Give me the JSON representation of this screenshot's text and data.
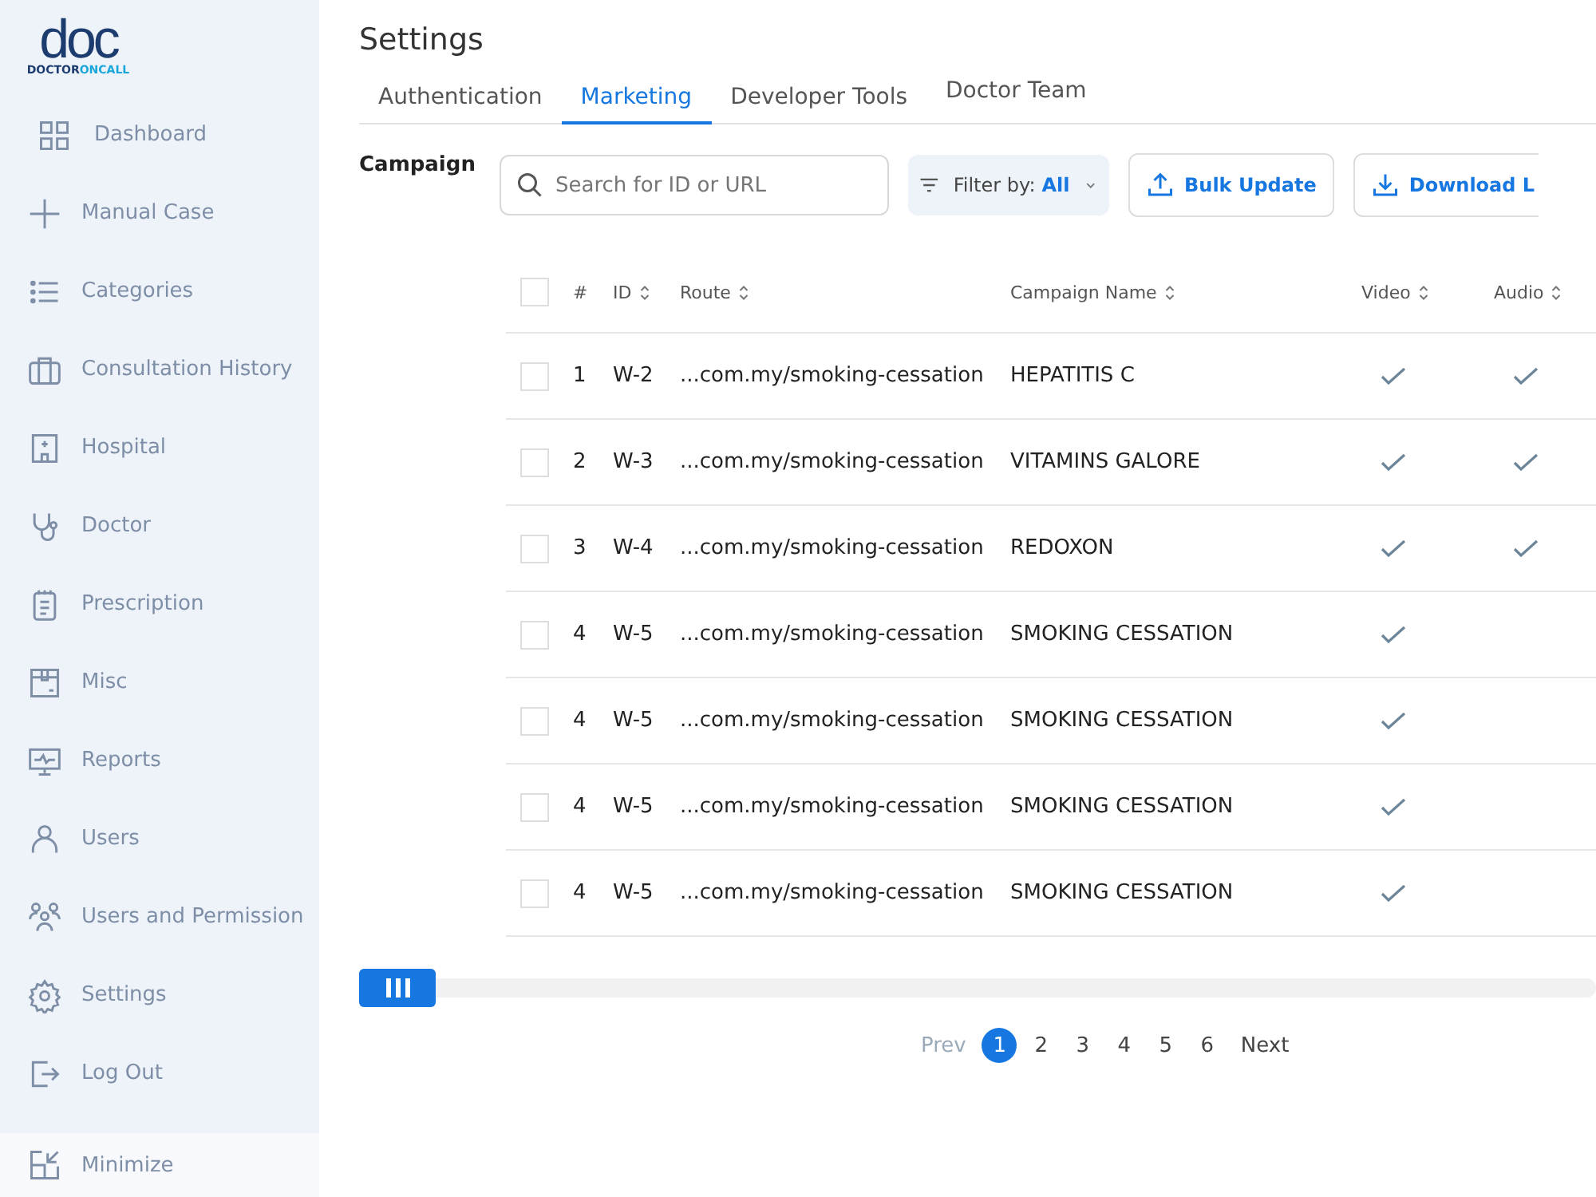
{
  "logo": {
    "mark": "doc",
    "name_a": "DOCTOR",
    "name_b": "ONCALL"
  },
  "sidebar": {
    "items": [
      {
        "label": "Dashboard",
        "selected": false
      },
      {
        "label": "Manual Case",
        "selected": false
      },
      {
        "label": "Categories",
        "selected": false
      },
      {
        "label": "Consultation History",
        "selected": false
      },
      {
        "label": "Hospital",
        "selected": false
      },
      {
        "label": "Doctor",
        "selected": false
      },
      {
        "label": "Prescription",
        "selected": false
      },
      {
        "label": "Misc",
        "selected": false
      },
      {
        "label": "Reports",
        "selected": false
      },
      {
        "label": "Users",
        "selected": false
      },
      {
        "label": "Users and Permission",
        "selected": false
      },
      {
        "label": "Settings",
        "selected": false
      },
      {
        "label": "Log Out",
        "selected": false
      }
    ],
    "minimize": "Minimize"
  },
  "page_title": "Settings",
  "tabs": [
    {
      "label": "Authentication",
      "selected": false
    },
    {
      "label": "Marketing",
      "selected": true
    },
    {
      "label": "Developer Tools",
      "selected": false
    },
    {
      "label": "Doctor Team",
      "selected": false
    }
  ],
  "section_label": "Campaign",
  "search": {
    "placeholder": "Search for ID or URL"
  },
  "filter": {
    "label": "Filter by:",
    "value": "All"
  },
  "buttons": [
    {
      "label": "Bulk Update",
      "kind": "upload"
    },
    {
      "label": "Download L",
      "kind": "download"
    }
  ],
  "table": {
    "select_all": {
      "checked": false
    },
    "columns": [
      "#",
      "ID",
      "Route",
      "Campaign Name",
      "Video",
      "Audio"
    ],
    "rows": [
      {
        "checked": false,
        "num": "1",
        "id": "W-2",
        "route": "...com.my/smoking-cessation",
        "campaign": "HEPATITIS C",
        "video": true,
        "audio": true
      },
      {
        "checked": false,
        "num": "2",
        "id": "W-3",
        "route": "...com.my/smoking-cessation",
        "campaign": "VITAMINS GALORE",
        "video": true,
        "audio": true
      },
      {
        "checked": false,
        "num": "3",
        "id": "W-4",
        "route": "...com.my/smoking-cessation",
        "campaign": "REDOXON",
        "video": true,
        "audio": true
      },
      {
        "checked": false,
        "num": "4",
        "id": "W-5",
        "route": "...com.my/smoking-cessation",
        "campaign": "SMOKING CESSATION",
        "video": true,
        "audio": false
      },
      {
        "checked": false,
        "num": "4",
        "id": "W-5",
        "route": "...com.my/smoking-cessation",
        "campaign": "SMOKING CESSATION",
        "video": true,
        "audio": false
      },
      {
        "checked": false,
        "num": "4",
        "id": "W-5",
        "route": "...com.my/smoking-cessation",
        "campaign": "SMOKING CESSATION",
        "video": true,
        "audio": false
      },
      {
        "checked": false,
        "num": "4",
        "id": "W-5",
        "route": "...com.my/smoking-cessation",
        "campaign": "SMOKING CESSATION",
        "video": true,
        "audio": false
      }
    ]
  },
  "pagination": {
    "prev": {
      "label": "Prev",
      "disabled": true
    },
    "pages": [
      {
        "label": "1",
        "selected": true
      },
      {
        "label": "2",
        "selected": false
      },
      {
        "label": "3",
        "selected": false
      },
      {
        "label": "4",
        "selected": false
      },
      {
        "label": "5",
        "selected": false
      },
      {
        "label": "6",
        "selected": false
      }
    ],
    "next": {
      "label": "Next",
      "disabled": false
    }
  }
}
